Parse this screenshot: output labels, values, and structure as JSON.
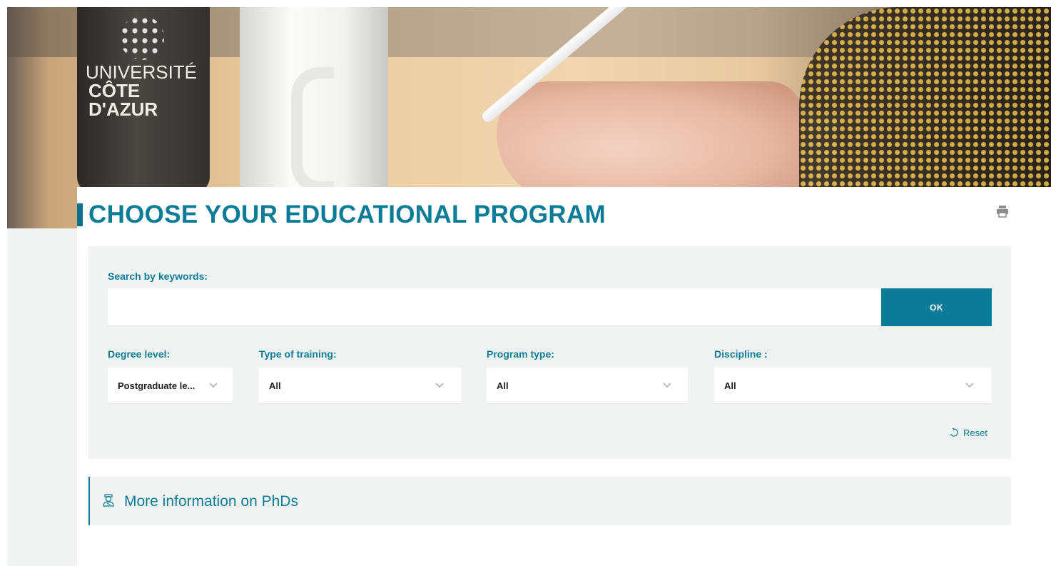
{
  "hero": {
    "logo_line1": "UNIVERSITÉ",
    "logo_line2": "CÔTE D'AZUR"
  },
  "page": {
    "title": "CHOOSE YOUR EDUCATIONAL PROGRAM",
    "print_icon": "printer-icon"
  },
  "search": {
    "keywords_label": "Search by keywords:",
    "keywords_value": "",
    "keywords_placeholder": "",
    "ok_label": "OK"
  },
  "filters": [
    {
      "label": "Degree level:",
      "value": "Postgraduate le..."
    },
    {
      "label": "Type of training:",
      "value": "All"
    },
    {
      "label": "Program type:",
      "value": "All"
    },
    {
      "label": "Discipline :",
      "value": "All"
    }
  ],
  "reset": {
    "label": "Reset",
    "icon": "reset-icon"
  },
  "phd": {
    "label": "More information on PhDs",
    "icon": "graduate-icon"
  },
  "colors": {
    "accent": "#0b7c97",
    "panel_bg": "#f2f4f4"
  }
}
